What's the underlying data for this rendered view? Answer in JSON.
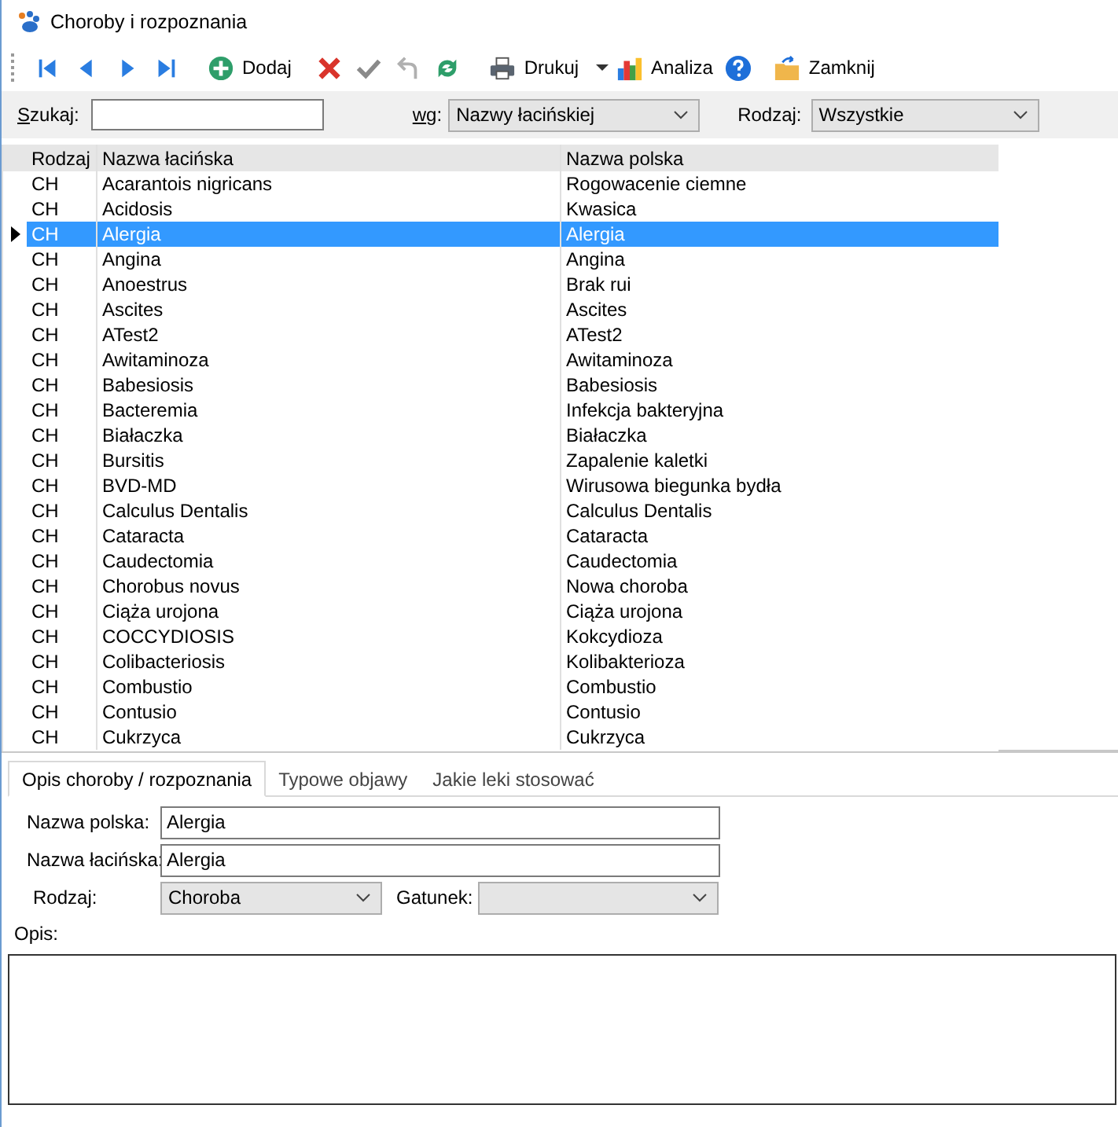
{
  "window": {
    "title": "Choroby i rozpoznania"
  },
  "toolbar": [
    {
      "kind": "first",
      "disabled": false
    },
    {
      "kind": "prev",
      "disabled": false
    },
    {
      "kind": "next",
      "disabled": false
    },
    {
      "kind": "last",
      "disabled": false
    },
    {
      "kind": "add",
      "label": "Dodaj",
      "disabled": false
    },
    {
      "kind": "delete",
      "disabled": false
    },
    {
      "kind": "confirm",
      "disabled": true
    },
    {
      "kind": "undo",
      "disabled": true
    },
    {
      "kind": "refresh",
      "disabled": false
    },
    {
      "kind": "print",
      "label": "Drukuj",
      "disabled": false
    },
    {
      "kind": "dropdown",
      "disabled": false
    },
    {
      "kind": "chart",
      "label": "Analiza",
      "disabled": false
    },
    {
      "kind": "help",
      "disabled": false
    },
    {
      "kind": "close",
      "label": "Zamknij",
      "disabled": false
    }
  ],
  "filter": {
    "search_label": "Szukaj:",
    "by_label": "wg:",
    "by_value": "Nazwy łacińskiej",
    "type_label": "Rodzaj:",
    "type_value": "Wszystkie"
  },
  "table": {
    "columns": [
      "Rodzaj",
      "Nazwa łacińska",
      "Nazwa polska"
    ],
    "rows": [
      {
        "cells": [
          "CH",
          "Acarantois nigricans",
          "Rogowacenie ciemne"
        ],
        "selected": false
      },
      {
        "cells": [
          "CH",
          "Acidosis",
          "Kwasica"
        ],
        "selected": false
      },
      {
        "cells": [
          "CH",
          "Alergia",
          "Alergia"
        ],
        "selected": true
      },
      {
        "cells": [
          "CH",
          "Angina",
          "Angina"
        ],
        "selected": false
      },
      {
        "cells": [
          "CH",
          "Anoestrus",
          "Brak rui"
        ],
        "selected": false
      },
      {
        "cells": [
          "CH",
          "Ascites",
          "Ascites"
        ],
        "selected": false
      },
      {
        "cells": [
          "CH",
          "ATest2",
          "ATest2"
        ],
        "selected": false
      },
      {
        "cells": [
          "CH",
          "Awitaminoza",
          "Awitaminoza"
        ],
        "selected": false
      },
      {
        "cells": [
          "CH",
          "Babesiosis",
          "Babesiosis"
        ],
        "selected": false
      },
      {
        "cells": [
          "CH",
          "Bacteremia",
          "Infekcja bakteryjna"
        ],
        "selected": false
      },
      {
        "cells": [
          "CH",
          "Białaczka",
          "Białaczka"
        ],
        "selected": false
      },
      {
        "cells": [
          "CH",
          "Bursitis",
          "Zapalenie kaletki"
        ],
        "selected": false
      },
      {
        "cells": [
          "CH",
          "BVD-MD",
          "Wirusowa biegunka bydła"
        ],
        "selected": false
      },
      {
        "cells": [
          "CH",
          "Calculus Dentalis",
          "Calculus Dentalis"
        ],
        "selected": false
      },
      {
        "cells": [
          "CH",
          "Cataracta",
          "Cataracta"
        ],
        "selected": false
      },
      {
        "cells": [
          "CH",
          "Caudectomia",
          "Caudectomia"
        ],
        "selected": false
      },
      {
        "cells": [
          "CH",
          "Chorobus novus",
          "Nowa choroba"
        ],
        "selected": false
      },
      {
        "cells": [
          "CH",
          "Ciąża urojona",
          "Ciąża urojona"
        ],
        "selected": false
      },
      {
        "cells": [
          "CH",
          "COCCYDIOSIS",
          "Kokcydioza"
        ],
        "selected": false
      },
      {
        "cells": [
          "CH",
          "Colibacteriosis",
          "Kolibakterioza"
        ],
        "selected": false
      },
      {
        "cells": [
          "CH",
          "Combustio",
          "Combustio"
        ],
        "selected": false
      },
      {
        "cells": [
          "CH",
          "Contusio",
          "Contusio"
        ],
        "selected": false
      },
      {
        "cells": [
          "CH",
          "Cukrzyca",
          "Cukrzyca"
        ],
        "selected": false
      }
    ]
  },
  "tabs": [
    {
      "label": "Opis choroby / rozpoznania",
      "selected": true
    },
    {
      "label": "Typowe objawy",
      "selected": false
    },
    {
      "label": "Jakie leki stosować",
      "selected": false
    }
  ],
  "form": {
    "polish_label": "Nazwa polska:",
    "polish_value": "Alergia",
    "latin_label": "Nazwa łacińska:",
    "latin_value": "Alergia",
    "type_label": "Rodzaj:",
    "type_value": "Choroba",
    "species_label": "Gatunek:",
    "description_label": "Opis:"
  }
}
